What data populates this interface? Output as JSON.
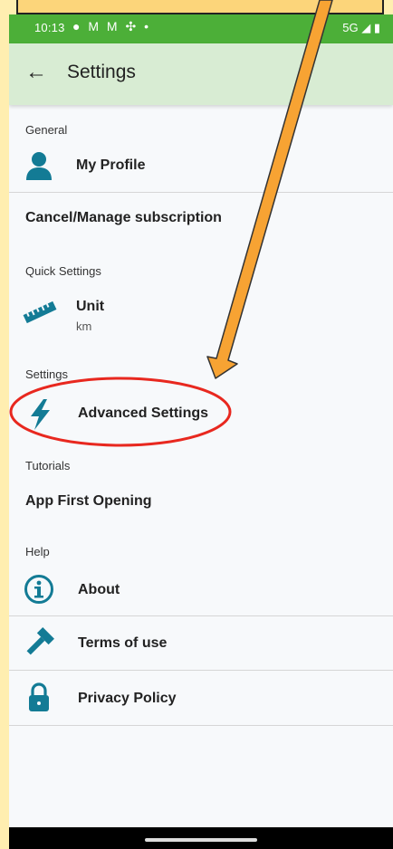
{
  "status_bar": {
    "time": "10:13",
    "icons": [
      "facebook-icon",
      "gmail-icon",
      "gmail-icon",
      "pinwheel-icon",
      "dot-icon"
    ],
    "right_text": "5G"
  },
  "app_bar": {
    "title": "Settings"
  },
  "sections": {
    "general": "General",
    "quick_settings": "Quick Settings",
    "settings": "Settings",
    "tutorials": "Tutorials",
    "help": "Help"
  },
  "items": {
    "my_profile": "My Profile",
    "cancel_subscription": "Cancel/Manage subscription",
    "unit_label": "Unit",
    "unit_value": "km",
    "advanced_settings": "Advanced Settings",
    "app_first_opening": "App First Opening",
    "about": "About",
    "terms_of_use": "Terms of use",
    "privacy_policy": "Privacy Policy"
  },
  "colors": {
    "status_bar": "#4caf38",
    "app_bar": "#d8ecd3",
    "icon_teal": "#137b95",
    "annotation_arrow": "#f7a333",
    "annotation_circle": "#e8281f",
    "page_background": "#ffeeb0"
  }
}
